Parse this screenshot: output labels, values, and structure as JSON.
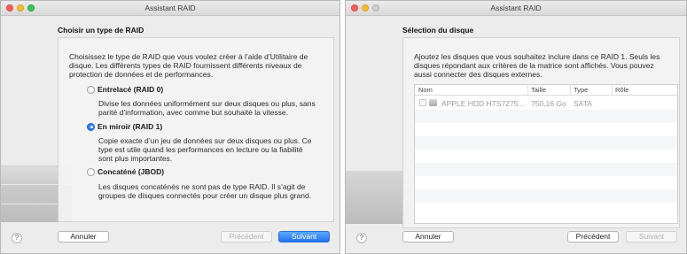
{
  "left_window": {
    "title": "Assistant RAID",
    "heading": "Choisir un type de RAID",
    "intro_lines": [
      "Choisissez le type de RAID que vous voulez créer à l’aide d’Utilitaire de",
      "disque. Les différents types de RAID fournissent différents niveaux de",
      "protection de données et de performances."
    ],
    "options": [
      {
        "label": "Entrelacé (RAID 0)",
        "selected": false,
        "desc_lines": [
          "Divise les données uniformément sur deux disques ou plus, sans",
          "parité d’information, avec comme but souhaité la vitesse."
        ]
      },
      {
        "label": "En miroir (RAID 1)",
        "selected": true,
        "desc_lines": [
          "Copie exacte d’un jeu de données sur deux disques ou plus. Ce",
          "type est utile quand les performances en lecture ou la fiabilité",
          "sont plus importantes."
        ]
      },
      {
        "label": "Concaténé (JBOD)",
        "selected": false,
        "desc_lines": [
          "Les disques concaténés ne sont pas de type RAID. Il s’agit de",
          "groupes de disques connectés pour créer un disque plus grand."
        ]
      }
    ],
    "help_label": "?",
    "buttons": {
      "cancel": "Annuler",
      "previous": "Précédent",
      "next": "Suivant"
    }
  },
  "right_window": {
    "title": "Assistant RAID",
    "heading": "Sélection du disque",
    "intro_lines": [
      "Ajoutez les disques que vous souhaitez inclure dans ce RAID 1. Seuls les",
      "disques répondant aux critères de la matrice sont affichés. Vous pouvez",
      "aussi connecter des disques externes."
    ],
    "table": {
      "columns": [
        "Nom",
        "Taille",
        "Type",
        "Rôle"
      ],
      "rows": [
        {
          "name": "APPLE HDD HTS7275...",
          "size": "750,16 Go",
          "type": "SATA",
          "role": ""
        }
      ]
    },
    "help_label": "?",
    "buttons": {
      "cancel": "Annuler",
      "previous": "Précédent",
      "next": "Suivant"
    }
  },
  "colors": {
    "accent": "#2f7bf5",
    "window_bg": "#ececec",
    "close": "#fc5f57",
    "minimize": "#fdbc2e",
    "zoom": "#35c84a"
  }
}
